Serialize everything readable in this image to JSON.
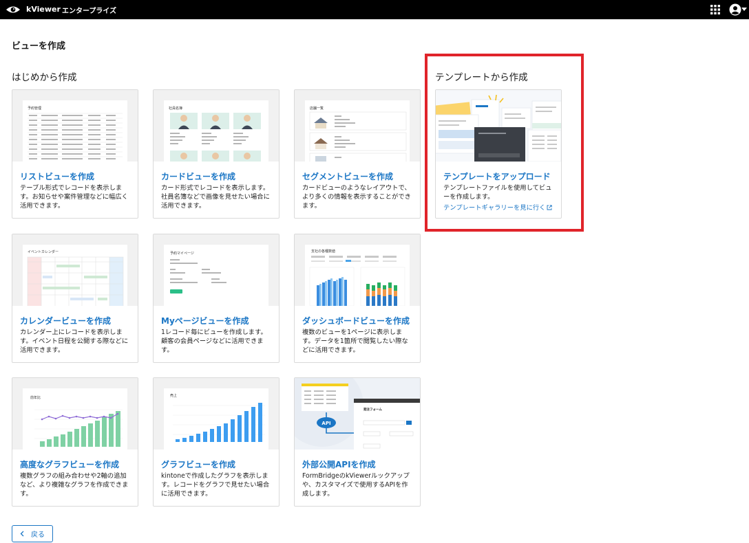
{
  "header": {
    "app_name": "kViewer",
    "edition": "エンタープライズ",
    "icons": [
      "kviewer-logo-icon",
      "apps-grid-icon",
      "user-account-icon",
      "caret-down-icon"
    ]
  },
  "page_title": "ビューを作成",
  "sections": {
    "scratch_title": "はじめから作成",
    "template_title": "テンプレートから作成"
  },
  "cards": {
    "list": {
      "title": "リストビューを作成",
      "desc": "テーブル形式でレコードを表示します。お知らせや案件管理などに幅広く活用できます。",
      "thumb_label": "予約管理"
    },
    "card": {
      "title": "カードビューを作成",
      "desc": "カード形式でレコードを表示します。社員名簿などで画像を見せたい場合に活用できます。",
      "thumb_label": "社員名簿"
    },
    "segment": {
      "title": "セグメントビューを作成",
      "desc": "カードビューのようなレイアウトで、より多くの情報を表示することができます。",
      "thumb_label": "店舗一覧"
    },
    "template": {
      "title": "テンプレートをアップロード",
      "desc": "テンプレートファイルを使用してビューを作成します。",
      "link": "テンプレートギャラリーを見に行く"
    },
    "calendar": {
      "title": "カレンダービューを作成",
      "desc": "カレンダー上にレコードを表示します。イベント日程を公開する際などに活用できます。",
      "thumb_label": "イベントカレンダー"
    },
    "mypage": {
      "title": "Myページビューを作成",
      "desc": "1レコード毎にビューを作成します。顧客の会員ページなどに活用できます。",
      "thumb_label": "予約マイページ"
    },
    "dashboard": {
      "title": "ダッシュボードビューを作成",
      "desc": "複数のビューを1ページに表示します。データを1箇所で閲覧したい際などに活用できます。",
      "thumb_label": "支社の各種数値"
    },
    "advanced_graph": {
      "title": "高度なグラフビューを作成",
      "desc": "複数グラフの組み合わせや2軸の追加など、より複雑なグラフを作成できます。",
      "thumb_label": "前年比"
    },
    "graph": {
      "title": "グラフビューを作成",
      "desc": "kintoneで作成したグラフを表示します。レコードをグラフで見せたい場合に活用できます。",
      "thumb_label": "売上"
    },
    "api": {
      "title": "外部公開APIを作成",
      "desc": "FormBridgeのkViewerルックアップや、カスタマイズで使用するAPIを作成します。",
      "thumb_api": "API",
      "thumb_form": "発注フォーム"
    }
  },
  "accent_color": "#1b76c5",
  "highlight_color": "#e0242a",
  "back_button": {
    "label": "戻る"
  }
}
